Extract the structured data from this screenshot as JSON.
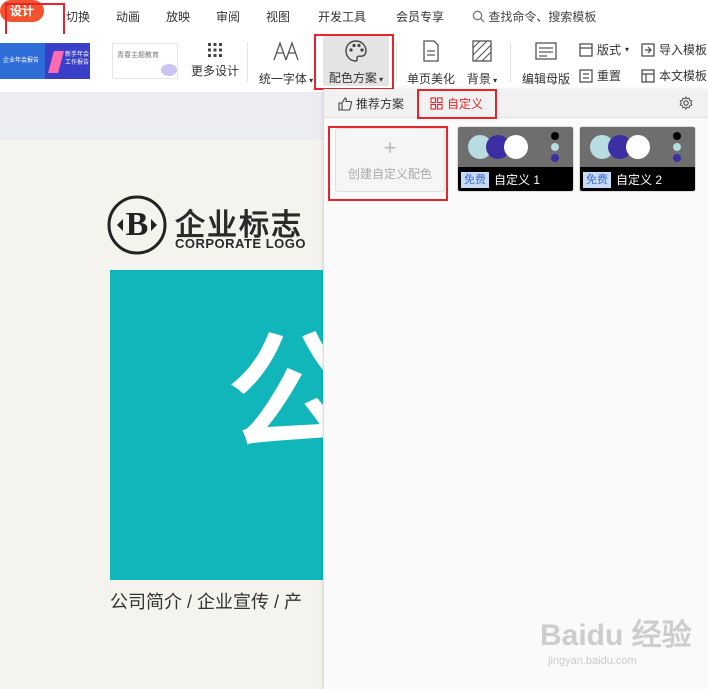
{
  "menu": {
    "tabs": [
      {
        "label": "设计"
      },
      {
        "label": "切换"
      },
      {
        "label": "动画"
      },
      {
        "label": "放映"
      },
      {
        "label": "审阅"
      },
      {
        "label": "视图"
      },
      {
        "label": "开发工具"
      },
      {
        "label": "会员专享"
      }
    ],
    "search_label": "查找命令、搜索模板"
  },
  "ribbon": {
    "thumbnails": [
      {
        "text": "企业年会报告"
      },
      {
        "text": "新手年会工作报告"
      },
      {
        "text": "青春主题教育"
      }
    ],
    "more_design": "更多设计",
    "unify_font": "统一字体",
    "color_scheme": "配色方案",
    "single_page_beautify": "单页美化",
    "background": "背景",
    "edit_master": "编辑母版",
    "layout": "版式",
    "reset": "重置",
    "import_template": "导入模板",
    "this_template": "本文模板"
  },
  "slide": {
    "logo_title": "企业标志",
    "logo_subtitle": "CORPORATE LOGO",
    "logo_letter": "B",
    "big_char": "公",
    "caption": "公司简介 / 企业宣传 / 产"
  },
  "panel": {
    "tab_recommended": "推荐方案",
    "tab_custom": "自定义",
    "create_custom": "创建自定义配色",
    "schemes": [
      {
        "name": "自定义 1",
        "badge": "免费"
      },
      {
        "name": "自定义 2",
        "badge": "免费"
      }
    ]
  },
  "watermark": {
    "brand": "Baidu 经验",
    "url": "jingyan.baidu.com"
  },
  "colors": {
    "accent": "#f2542d",
    "highlight": "#e8232b",
    "teal": "#10b6b9",
    "scheme_light_blue": "#b8dde0",
    "scheme_indigo": "#3b2fa3",
    "scheme_white": "#ffffff",
    "scheme_gray": "#6e6e6e"
  }
}
